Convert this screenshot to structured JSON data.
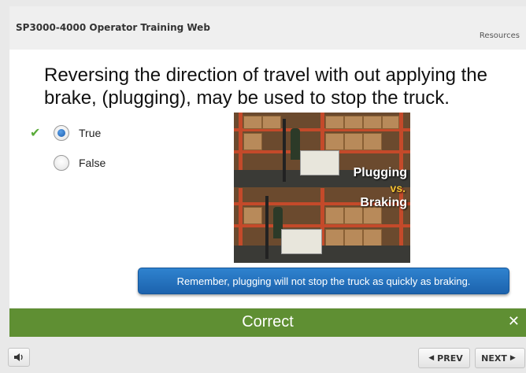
{
  "header": {
    "course_title": "SP3000-4000 Operator Training Web",
    "resources_label": "Resources"
  },
  "question": {
    "text": "Reversing the direction of travel with out applying the brake, (plugging), may be used to stop the truck.",
    "options": [
      {
        "label": "True",
        "selected": true,
        "correct": true
      },
      {
        "label": "False",
        "selected": false,
        "correct": false
      }
    ]
  },
  "image": {
    "caption_line1": "Plugging",
    "caption_line2": "vs.",
    "caption_line3": "Braking"
  },
  "tooltip": {
    "text": "Remember, plugging will not stop the truck as quickly as braking."
  },
  "feedback": {
    "label": "Correct",
    "close_symbol": "✕",
    "color": "#5f8f33"
  },
  "footer": {
    "prev_label": "PREV",
    "next_label": "NEXT"
  },
  "icons": {
    "check": "checkmark-icon",
    "sound": "speaker-icon",
    "prev": "chevron-left-icon",
    "next": "chevron-right-icon"
  }
}
